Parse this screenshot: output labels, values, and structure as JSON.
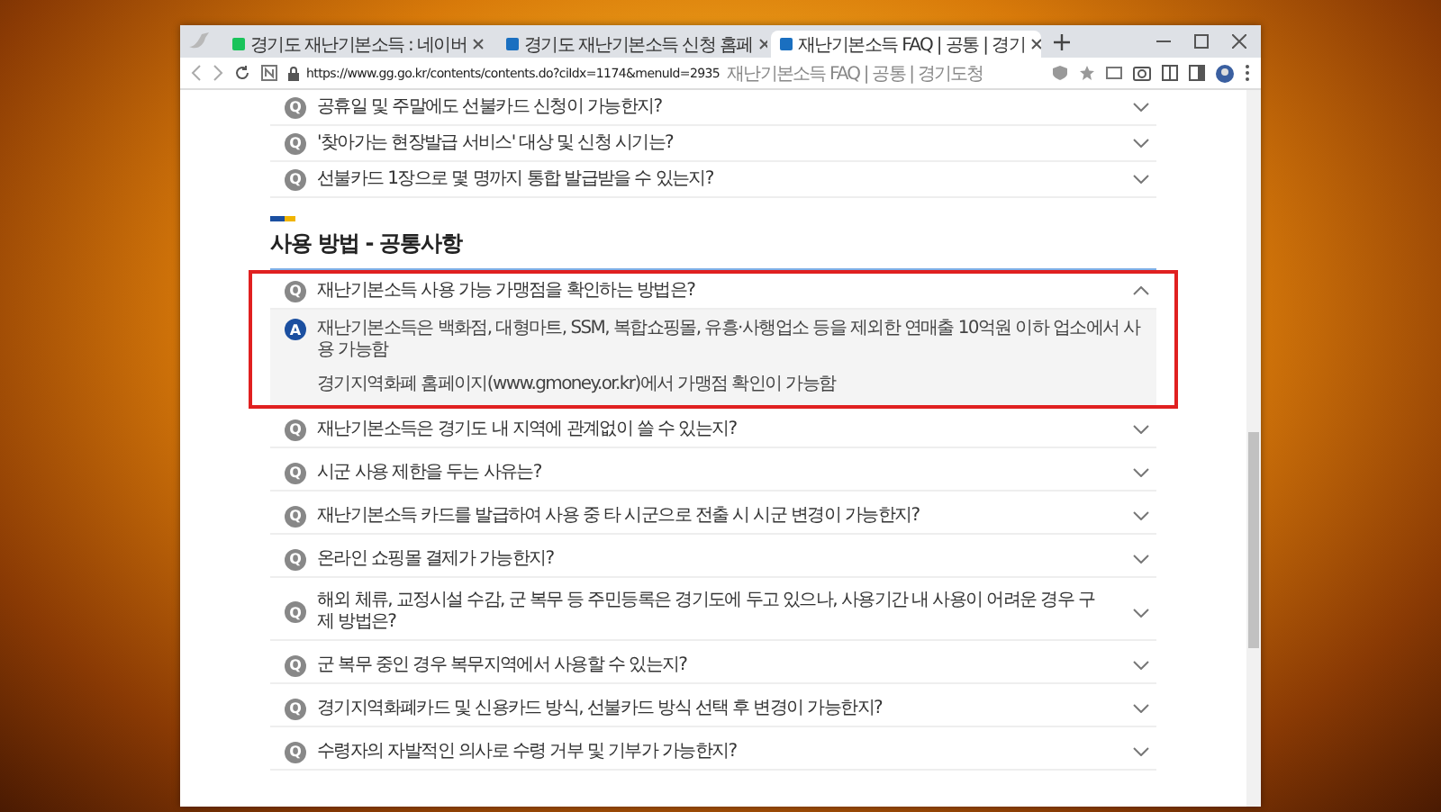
{
  "browser": {
    "tabs": [
      {
        "label": "경기도 재난기본소득 : 네이버",
        "selected": false,
        "color": "#19c35a"
      },
      {
        "label": "경기도 재난기본소득 신청 홈페",
        "selected": false,
        "color": "#1a6fc0"
      },
      {
        "label": "재난기본소득 FAQ | 공통 | 경기",
        "selected": true,
        "color": "#1a6fc0"
      }
    ],
    "address_bar": {
      "url": "https://www.gg.go.kr/contents/contents.do?ciIdx=1174&menuId=2935",
      "page_title": "재난기본소득 FAQ | 공통 | 경기도청"
    }
  },
  "faq_before": [
    {
      "q_badge": "Q",
      "question": "공휴일 및 주말에도 선불카드 신청이 가능한지?",
      "expanded": false
    },
    {
      "q_badge": "Q",
      "question": "'찾아가는 현장발급 서비스' 대상 및 신청 시기는?",
      "expanded": false
    },
    {
      "q_badge": "Q",
      "question": "선불카드 1장으로 몇 명까지 통합 발급받을 수 있는지?",
      "expanded": false
    }
  ],
  "section": {
    "title": "사용 방법 - 공통사항"
  },
  "faq": [
    {
      "q_badge": "Q",
      "question": "재난기본소득 사용 가능 가맹점을 확인하는 방법은?",
      "expanded": true,
      "highlighted": true,
      "a_badge": "A",
      "answer": [
        "재난기본소득은 백화점, 대형마트, SSM, 복합쇼핑몰, 유흥·사행업소 등을 제외한 연매출 10억원 이하 업소에서 사용 가능함",
        "경기지역화폐 홈페이지(www.gmoney.or.kr)에서 가맹점 확인이 가능함"
      ]
    },
    {
      "q_badge": "Q",
      "question": "재난기본소득은 경기도 내 지역에 관계없이 쓸 수 있는지?",
      "expanded": false,
      "highlighted": false
    },
    {
      "q_badge": "Q",
      "question": "시군 사용 제한을 두는 사유는?",
      "expanded": false,
      "highlighted": false
    },
    {
      "q_badge": "Q",
      "question": "재난기본소득 카드를 발급하여 사용 중 타 시군으로 전출 시 시군 변경이 가능한지?",
      "expanded": false,
      "highlighted": false
    },
    {
      "q_badge": "Q",
      "question": "온라인 쇼핑몰 결제가 가능한지?",
      "expanded": false,
      "highlighted": false
    },
    {
      "q_badge": "Q",
      "question": "해외 체류, 교정시설 수감, 군 복무 등 주민등록은 경기도에 두고 있으나, 사용기간 내 사용이 어려운 경우 구제 방법은?",
      "expanded": false,
      "highlighted": false
    },
    {
      "q_badge": "Q",
      "question": "군 복무 중인 경우 복무지역에서 사용할 수 있는지?",
      "expanded": false,
      "highlighted": false
    },
    {
      "q_badge": "Q",
      "question": "경기지역화폐카드 및 신용카드 방식, 선불카드 방식 선택 후 변경이 가능한지?",
      "expanded": false,
      "highlighted": false
    },
    {
      "q_badge": "Q",
      "question": "수령자의 자발적인 의사로 수령 거부 및 기부가 가능한지?",
      "expanded": false,
      "highlighted": false
    }
  ]
}
